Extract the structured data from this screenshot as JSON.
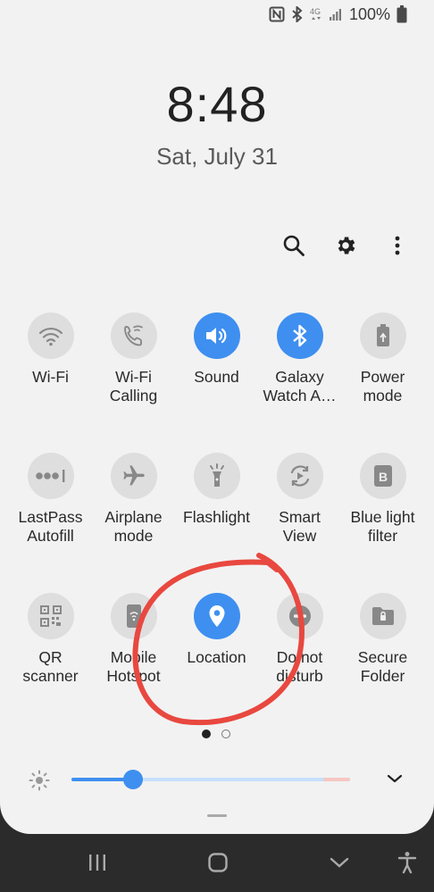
{
  "status": {
    "battery": "100%"
  },
  "clock": {
    "time": "8:48",
    "date": "Sat, July 31"
  },
  "toolbar": {
    "icons": [
      "search-icon",
      "settings-icon",
      "more-icon"
    ]
  },
  "tiles": [
    {
      "label": "Wi-Fi",
      "icon": "wifi-icon",
      "on": false
    },
    {
      "label": "Wi-Fi\nCalling",
      "icon": "wifi-calling-icon",
      "on": false
    },
    {
      "label": "Sound",
      "icon": "speaker-icon",
      "on": true
    },
    {
      "label": "Galaxy\nWatch A…",
      "icon": "bluetooth-icon",
      "on": true
    },
    {
      "label": "Power\nmode",
      "icon": "battery-saver-icon",
      "on": false
    },
    {
      "label": "LastPass\nAutofill",
      "icon": "lastpass-icon",
      "on": false
    },
    {
      "label": "Airplane\nmode",
      "icon": "airplane-icon",
      "on": false
    },
    {
      "label": "Flashlight",
      "icon": "flashlight-icon",
      "on": false
    },
    {
      "label": "Smart\nView",
      "icon": "smart-view-icon",
      "on": false
    },
    {
      "label": "Blue light\nfilter",
      "icon": "blue-light-icon",
      "on": false
    },
    {
      "label": "QR\nscanner",
      "icon": "qr-icon",
      "on": false
    },
    {
      "label": "Mobile\nHotspot",
      "icon": "hotspot-icon",
      "on": false
    },
    {
      "label": "Location",
      "icon": "location-pin-icon",
      "on": true
    },
    {
      "label": "Do not\ndisturb",
      "icon": "do-not-disturb-icon",
      "on": false
    },
    {
      "label": "Secure\nFolder",
      "icon": "secure-folder-icon",
      "on": false
    }
  ],
  "pager": {
    "current": 1,
    "total": 2
  },
  "brightness": {
    "level": 0.22
  },
  "colors": {
    "accent": "#3e8ff0",
    "annotation": "#e8483f",
    "panel": "#f2f2f2"
  }
}
